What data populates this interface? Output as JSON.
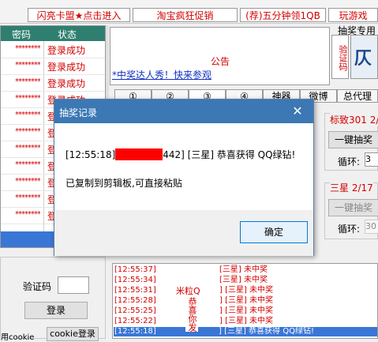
{
  "top_links": [
    "闪亮卡盟★点击进入",
    "淘宝疯狂促销",
    "(荐)五分钟领1QB",
    "玩游戏"
  ],
  "account_table": {
    "headers": [
      "密码",
      "状态"
    ],
    "rows": [
      {
        "pw": "********",
        "status": "登录成功"
      },
      {
        "pw": "********",
        "status": "登录成功"
      },
      {
        "pw": "********",
        "status": "登录成功"
      },
      {
        "pw": "********",
        "status": "登录成功"
      },
      {
        "pw": "********",
        "status": "登"
      },
      {
        "pw": "********",
        "status": "登"
      },
      {
        "pw": "********",
        "status": "登"
      },
      {
        "pw": "********",
        "status": "登"
      },
      {
        "pw": "********",
        "status": "登"
      },
      {
        "pw": "********",
        "status": "登"
      },
      {
        "pw": "********",
        "status": "登"
      },
      {
        "pw": "",
        "status": ""
      }
    ]
  },
  "notice": {
    "label": "公告",
    "link": "*中奖达人秀！快来参观"
  },
  "captcha_panel": {
    "label": "抽奖专用",
    "vertical": "验证码"
  },
  "tabs": [
    "①",
    "②",
    "③",
    "④",
    "神器",
    "微博",
    "总代理"
  ],
  "panel1": {
    "title": "标致301 2/",
    "draw_button": "一键抽奖",
    "loop_label": "循环:",
    "loop_value": "3"
  },
  "panel2": {
    "title": "三星 2/17",
    "draw_button": "一键抽奖",
    "loop_label": "循环:",
    "loop_value": "30"
  },
  "login": {
    "captcha_label": "验证码",
    "login_button": "登录",
    "cookie_label": "用cookie",
    "cookie_button": "cookie登录"
  },
  "log": {
    "side_label": "米粒Q",
    "side_vertical": "恭喜你发",
    "lines": [
      {
        "time": "[12:55:37]",
        "msg": "[三星] 未中奖"
      },
      {
        "time": "[12:55:34]",
        "msg": " [三星] 未中奖"
      },
      {
        "time": "[12:55:31]",
        "msg": "] [三星] 未中奖"
      },
      {
        "time": "[12:55:28]",
        "msg": "] [三星] 未中奖"
      },
      {
        "time": "[12:55:25]",
        "msg": "] [三星] 未中奖"
      },
      {
        "time": "[12:55:22]",
        "msg": "] [三星] 未中奖"
      },
      {
        "time": "[12:55:18]",
        "msg": "] [三星] 恭喜获得 QQ绿钻!"
      }
    ]
  },
  "dialog": {
    "title": "抽奖记录",
    "close": "✕",
    "line1_prefix": "[12:55:18]",
    "line1_suffix": "442] [三星] 恭喜获得 QQ绿钻!",
    "line2": "已复制到剪辑板,可直接粘贴",
    "ok_button": "确定"
  }
}
